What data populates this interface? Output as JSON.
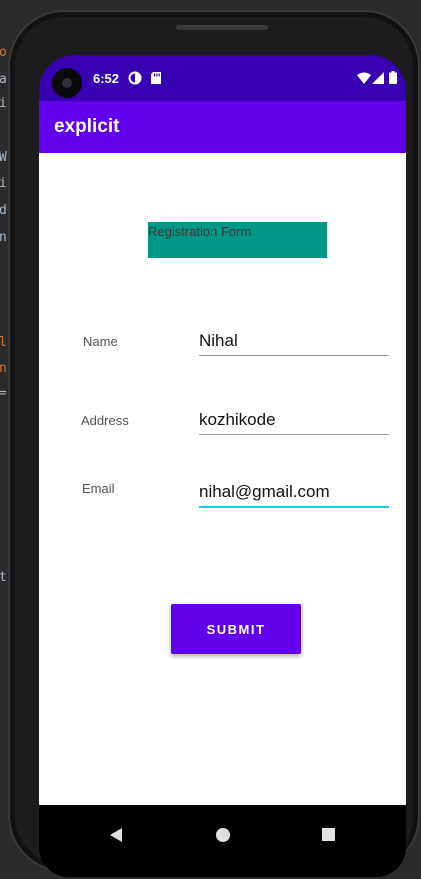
{
  "ide": {
    "fragments": [
      "o",
      "a",
      "i",
      "W",
      "i",
      "d",
      "n",
      "l",
      "n",
      "=",
      "t"
    ]
  },
  "status_bar": {
    "time": "6:52",
    "icons": [
      "camera-icon",
      "data-saver-icon",
      "sd-card-icon",
      "wifi-icon",
      "cellular-signal-icon",
      "battery-icon"
    ]
  },
  "app_bar": {
    "title": "explicit"
  },
  "form": {
    "title": "Registration Form",
    "name_label": "Name",
    "name_value": "Nihal",
    "address_label": "Address",
    "address_value": "kozhikode",
    "email_label": "Email",
    "email_value": "nihal@gmail.com",
    "submit_label": "SUBMIT"
  },
  "nav_bar": {
    "icons": [
      "back-icon",
      "home-icon",
      "recents-icon"
    ]
  },
  "colors": {
    "status_bar": "#3700b3",
    "app_bar": "#6200ee",
    "title_background": "#009688",
    "button": "#6200ee",
    "focus_underline": "#26c6da"
  }
}
